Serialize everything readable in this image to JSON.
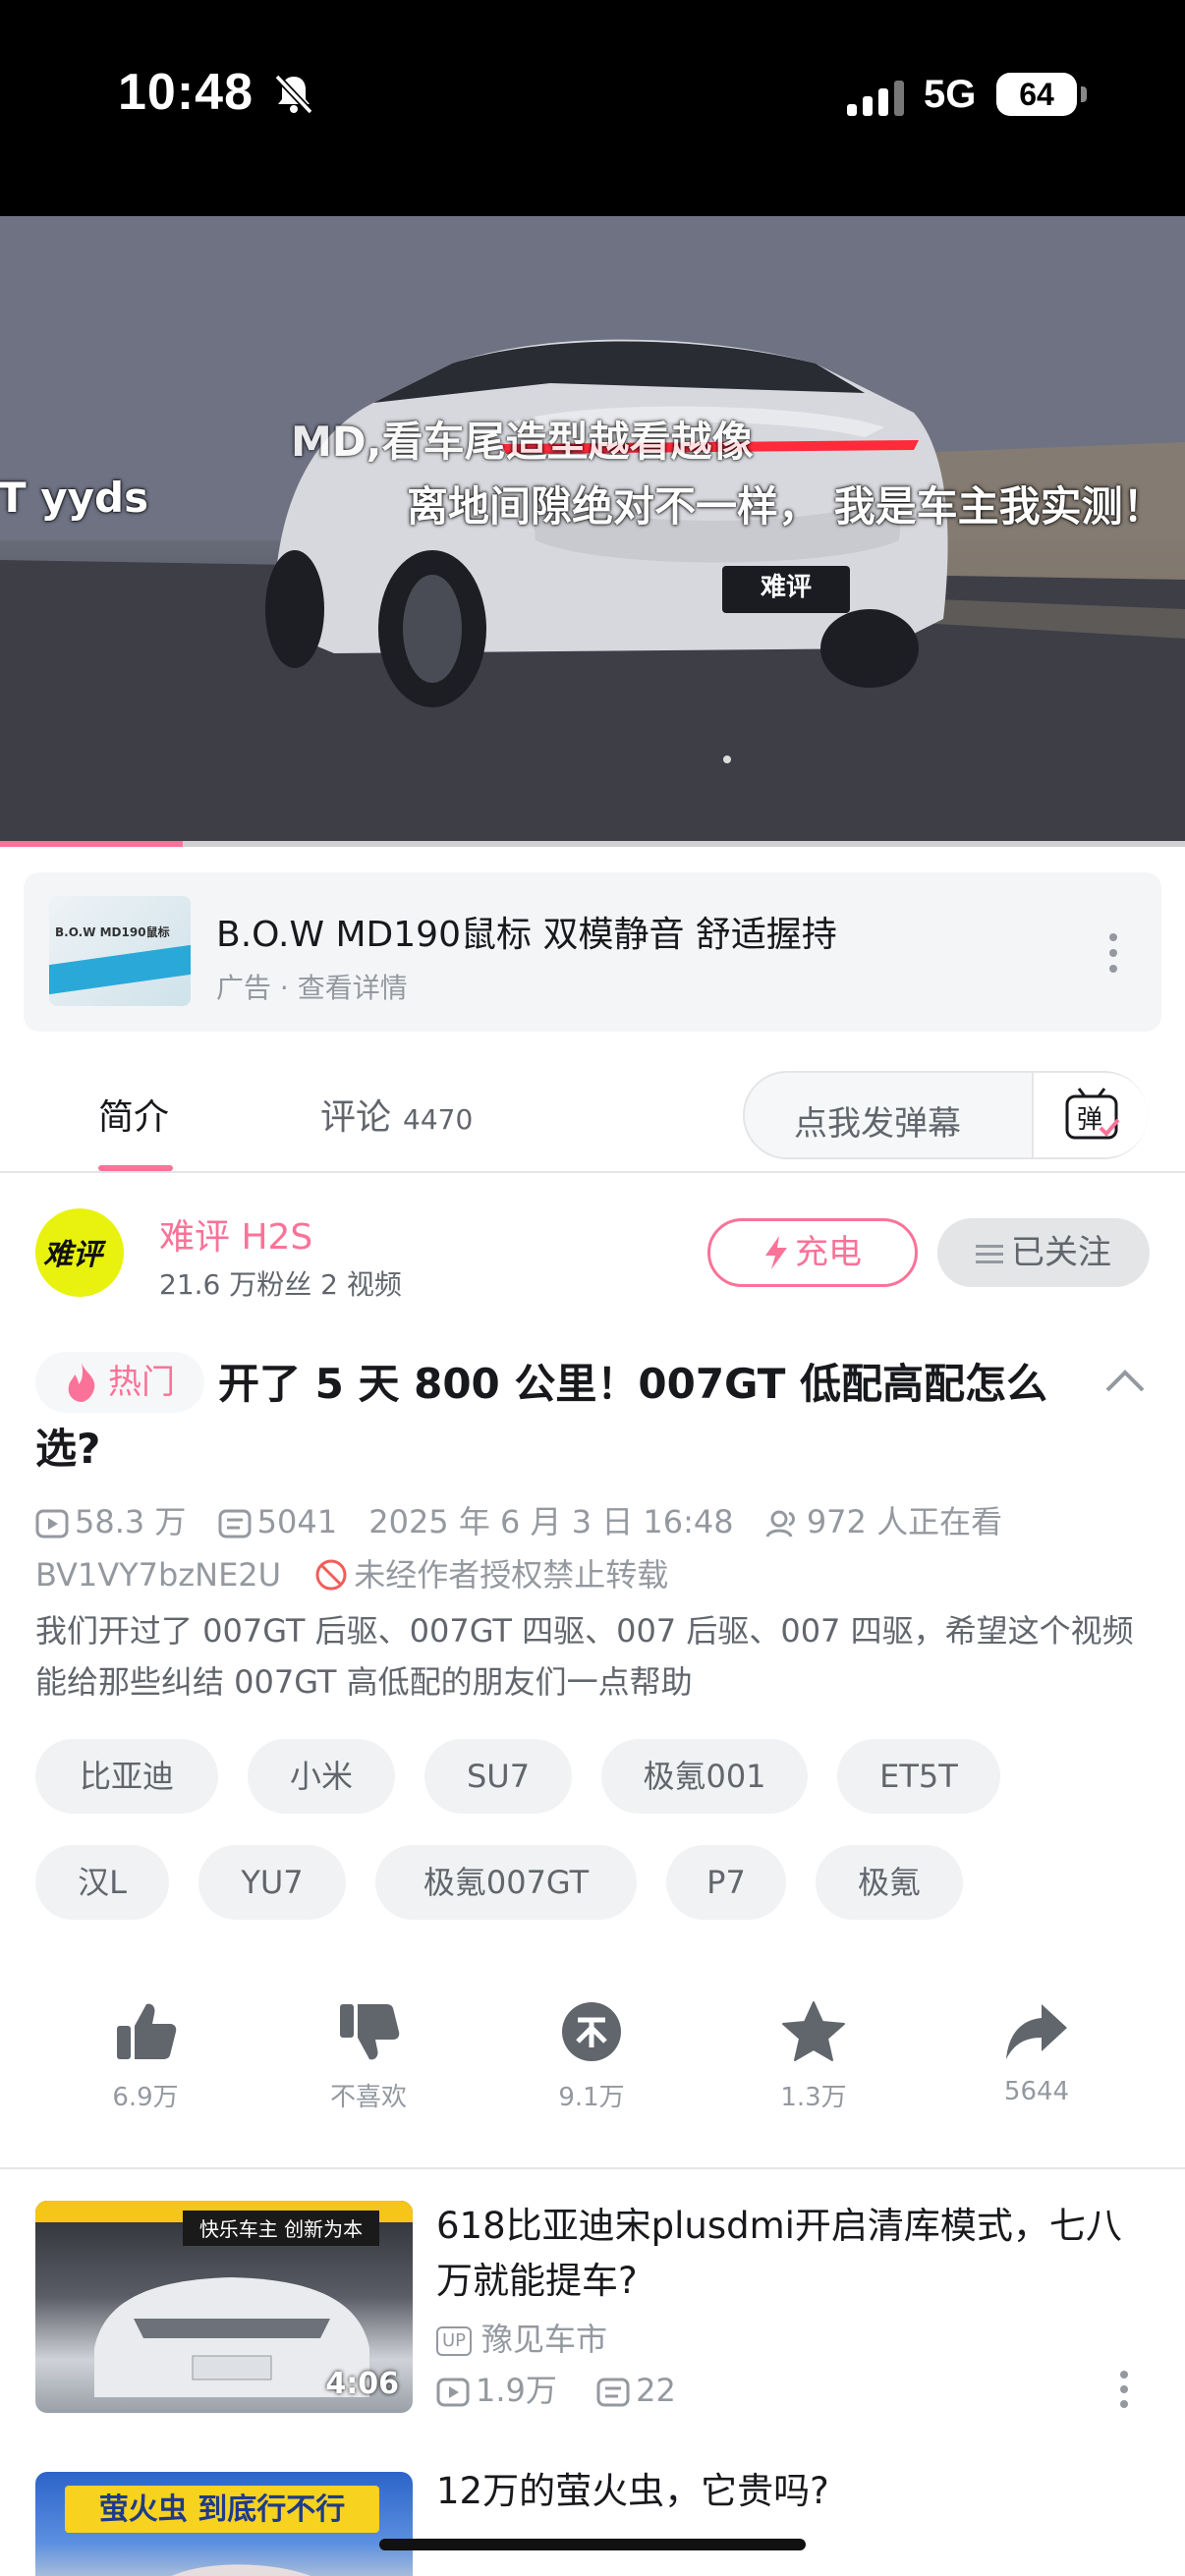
{
  "status_bar": {
    "time": "10:48",
    "network": "5G",
    "battery": "64"
  },
  "video": {
    "danmaku": [
      "MD,看车尾造型越看越像",
      "T yyds",
      "离地间隙绝对不一样， 我是车主我实测！"
    ],
    "progress": 0.154,
    "plate_text": "难评"
  },
  "ad": {
    "title": "B.O.W MD190鼠标 双模静音 舒适握持",
    "subtitle": "广告 · 查看详情",
    "thumb_text": "B.O.W MD190鼠标"
  },
  "tabs": {
    "intro": "简介",
    "comments": "评论",
    "comments_count": "4470",
    "danmaku_placeholder": "点我发弹幕",
    "danmaku_button": "弹"
  },
  "uploader": {
    "avatar_text": "难评",
    "name": "难评 H2S",
    "stats": "21.6 万粉丝  2 视频",
    "charge_label": "充电",
    "follow_label": "已关注"
  },
  "video_info": {
    "hot_label": "热门",
    "title": "开了 5 天 800 公里！007GT 低配高配怎么选?",
    "views": "58.3 万",
    "danmaku_count": "5041",
    "date": "2025 年 6 月 3 日 16:48",
    "watching": "972 人正在看",
    "bvid": "BV1VY7bzNE2U",
    "copyright": "未经作者授权禁止转载",
    "description": "我们开过了 007GT 后驱、007GT 四驱、007 后驱、007 四驱，希望这个视频能给那些纠结 007GT 高低配的朋友们一点帮助"
  },
  "tags": [
    "比亚迪",
    "小米",
    "SU7",
    "极氪001",
    "ET5T",
    "汉L",
    "YU7",
    "极氪007GT",
    "P7",
    "极氪"
  ],
  "actions": {
    "like": "6.9万",
    "dislike": "不喜欢",
    "coin": "9.1万",
    "favorite": "1.3万",
    "share": "5644"
  },
  "recommendations": [
    {
      "title": "618比亚迪宋plusdmi开启清库模式，七八万就能提车?",
      "up_badge": "UP",
      "uploader": "豫见车市",
      "views": "1.9万",
      "danmaku": "22",
      "duration": "4:06",
      "thumb_text": "快乐车主 创新为本"
    },
    {
      "title": "12万的萤火虫，它贵吗?",
      "thumb_text": "萤火虫 到底行不行"
    }
  ],
  "colors": {
    "accent": "#fb7299",
    "text": "#18191c",
    "muted": "#9499a0"
  }
}
